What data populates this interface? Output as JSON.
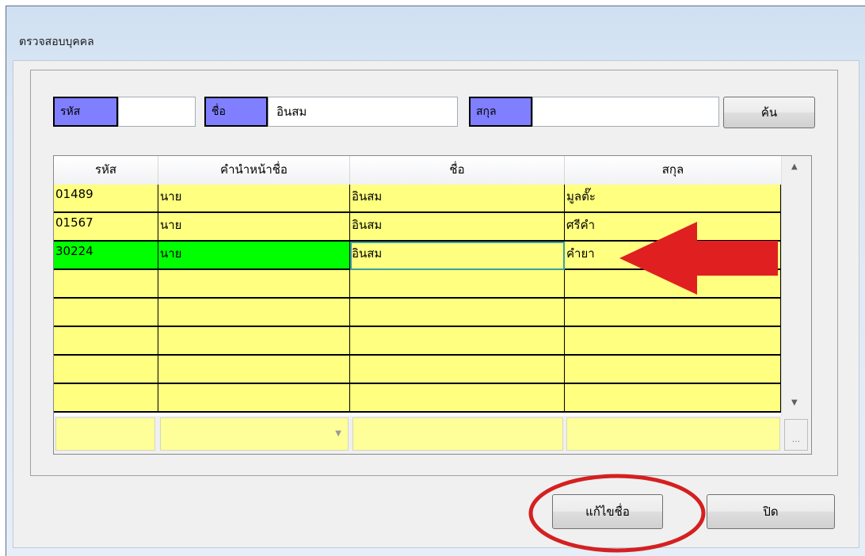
{
  "window": {
    "title": "ตรวจสอบบุคคล"
  },
  "search": {
    "code_label": "รหัส",
    "code_value": "",
    "name_label": "ชื่อ",
    "name_value": "อินสม",
    "surname_label": "สกุล",
    "surname_value": "",
    "search_button": "ค้น"
  },
  "grid": {
    "columns": [
      "รหัส",
      "คำนำหน้าชื่อ",
      "ชื่อ",
      "สกุล"
    ],
    "rows": [
      [
        "01489",
        "นาย",
        "อินสม",
        "มูลตั๊ะ"
      ],
      [
        "01567",
        "นาย",
        "อินสม",
        "ศรีคำ"
      ],
      [
        "30224",
        "นาย",
        "อินสม",
        "คำยา"
      ],
      [
        "",
        "",
        "",
        ""
      ],
      [
        "",
        "",
        "",
        ""
      ],
      [
        "",
        "",
        "",
        ""
      ],
      [
        "",
        "",
        "",
        ""
      ],
      [
        "",
        "",
        "",
        ""
      ]
    ],
    "selected_row_index": 2,
    "selected_row_color": "#00ff00",
    "row_color": "#ffff80",
    "label_color": "#7f7fff",
    "new_row_ellipsis": "..."
  },
  "footer": {
    "edit_name_button": "แก้ไขชื่อ",
    "close_button": "ปิด"
  },
  "annotations": {
    "arrow_color": "#e02020",
    "circle_color": "#d42020"
  }
}
